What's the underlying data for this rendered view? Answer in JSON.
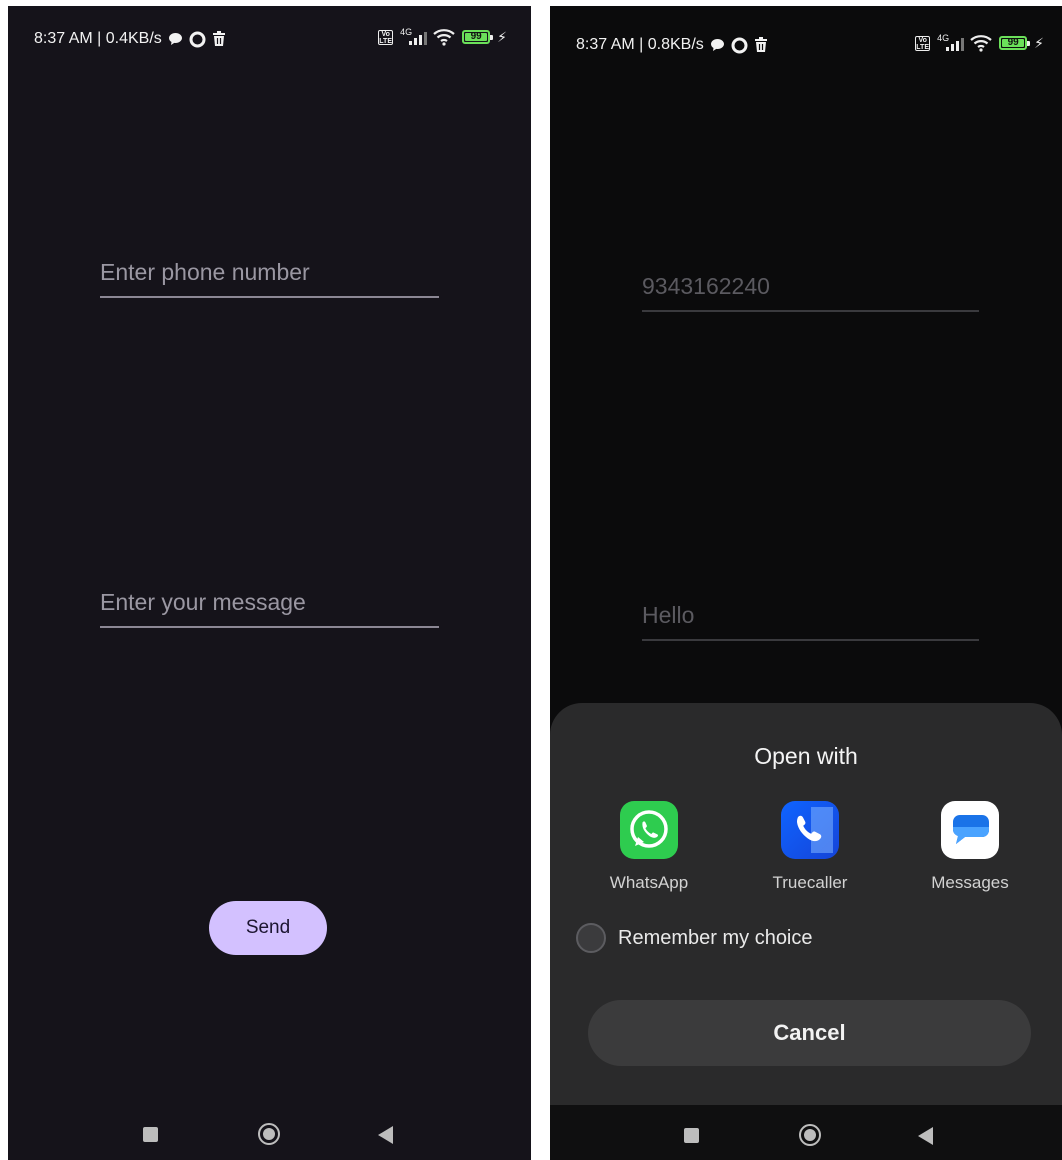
{
  "left": {
    "status": {
      "time_speed": "8:37 AM | 0.4KB/s",
      "battery": "99"
    },
    "phone_field": {
      "placeholder": "Enter phone number"
    },
    "message_field": {
      "placeholder": "Enter your message"
    },
    "send_label": "Send"
  },
  "right": {
    "status": {
      "time_speed": "8:37 AM | 0.8KB/s",
      "battery": "99"
    },
    "phone_value": "9343162240",
    "message_value": "Hello",
    "sheet": {
      "title": "Open with",
      "apps": [
        {
          "label": "WhatsApp",
          "icon": "whatsapp-icon"
        },
        {
          "label": "Truecaller",
          "icon": "truecaller-icon"
        },
        {
          "label": "Messages",
          "icon": "messages-icon"
        }
      ],
      "remember_label": "Remember my choice",
      "cancel_label": "Cancel"
    }
  },
  "colors": {
    "left_background": "#15131a",
    "right_background": "#0b0b0c",
    "send_button": "#d3c1ff",
    "sheet_background": "#2a2a2b",
    "battery": "#6be05a",
    "status_icons": [
      "chat-bubble-icon",
      "data-saver-icon",
      "trash-icon",
      "volte-icon",
      "4g-signal-icon",
      "wifi-icon",
      "battery-icon",
      "charging-icon"
    ],
    "nav_icons": [
      "recents-icon",
      "home-icon",
      "back-icon"
    ]
  }
}
